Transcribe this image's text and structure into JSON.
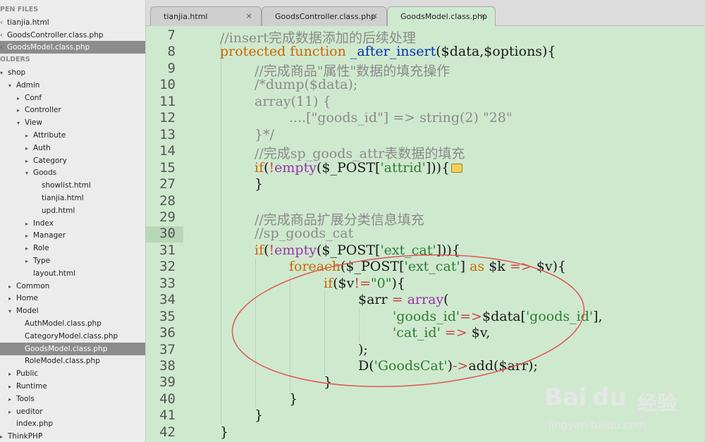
{
  "sidebar": {
    "open_files_header": "PEN FILES",
    "open_files": [
      {
        "label": "tianjia.html",
        "selected": false
      },
      {
        "label": "GoodsController.class.php",
        "selected": false
      },
      {
        "label": "GoodsModel.class.php",
        "selected": true
      }
    ],
    "folders_header": "OLDERS",
    "tree": [
      {
        "label": "shop",
        "arrow": "▾",
        "depth": 0
      },
      {
        "label": "Admin",
        "arrow": "▾",
        "depth": 1
      },
      {
        "label": "Conf",
        "arrow": "▸",
        "depth": 2
      },
      {
        "label": "Controller",
        "arrow": "▸",
        "depth": 2
      },
      {
        "label": "View",
        "arrow": "▾",
        "depth": 2
      },
      {
        "label": "Attribute",
        "arrow": "▸",
        "depth": 3
      },
      {
        "label": "Auth",
        "arrow": "▸",
        "depth": 3
      },
      {
        "label": "Category",
        "arrow": "▸",
        "depth": 3
      },
      {
        "label": "Goods",
        "arrow": "▾",
        "depth": 3
      },
      {
        "label": "showlist.html",
        "arrow": "",
        "depth": 4
      },
      {
        "label": "tianjia.html",
        "arrow": "",
        "depth": 4
      },
      {
        "label": "upd.html",
        "arrow": "",
        "depth": 4
      },
      {
        "label": "Index",
        "arrow": "▸",
        "depth": 3
      },
      {
        "label": "Manager",
        "arrow": "▸",
        "depth": 3
      },
      {
        "label": "Role",
        "arrow": "▸",
        "depth": 3
      },
      {
        "label": "Type",
        "arrow": "▸",
        "depth": 3
      },
      {
        "label": "layout.html",
        "arrow": "",
        "depth": 3
      },
      {
        "label": "Common",
        "arrow": "▸",
        "depth": 1
      },
      {
        "label": "Home",
        "arrow": "▸",
        "depth": 1
      },
      {
        "label": "Model",
        "arrow": "▾",
        "depth": 1
      },
      {
        "label": "AuthModel.class.php",
        "arrow": "",
        "depth": 2
      },
      {
        "label": "CategoryModel.class.php",
        "arrow": "",
        "depth": 2
      },
      {
        "label": "GoodsModel.class.php",
        "arrow": "",
        "depth": 2,
        "selected": true
      },
      {
        "label": "RoleModel.class.php",
        "arrow": "",
        "depth": 2
      },
      {
        "label": "Public",
        "arrow": "▸",
        "depth": 1
      },
      {
        "label": "Runtime",
        "arrow": "▸",
        "depth": 1
      },
      {
        "label": "Tools",
        "arrow": "▸",
        "depth": 1
      },
      {
        "label": "ueditor",
        "arrow": "▸",
        "depth": 1
      },
      {
        "label": "index.php",
        "arrow": "",
        "depth": 1
      },
      {
        "label": "ThinkPHP",
        "arrow": "▸",
        "depth": 0
      }
    ]
  },
  "tabs": [
    {
      "label": "tianjia.html",
      "close": "×",
      "active": false
    },
    {
      "label": "GoodsController.class.php",
      "close": "×",
      "active": false
    },
    {
      "label": "GoodsModel.class.php",
      "close": "×",
      "active": true
    }
  ],
  "editor": {
    "lines": [
      {
        "num": "7",
        "indent": 1,
        "tokens": [
          [
            "c-comment",
            "//insert完成数据添加的后续处理"
          ]
        ]
      },
      {
        "num": "8",
        "indent": 1,
        "tokens": [
          [
            "c-kw",
            "protected "
          ],
          [
            "c-kw",
            "function "
          ],
          [
            "c-fn",
            "_after_insert"
          ],
          [
            "c-plain",
            "($data,$options){"
          ]
        ]
      },
      {
        "num": "9",
        "indent": 2,
        "tokens": [
          [
            "c-comment",
            "//完成商品\"属性\"数据的填充操作"
          ]
        ]
      },
      {
        "num": "10",
        "indent": 2,
        "tokens": [
          [
            "c-comment",
            "/*dump($data);"
          ]
        ]
      },
      {
        "num": "11",
        "indent": 2,
        "tokens": [
          [
            "c-comment",
            "array(11) {"
          ]
        ]
      },
      {
        "num": "12",
        "indent": 3,
        "tokens": [
          [
            "c-comment",
            "....[\"goods_id\"] => string(2) \"28\""
          ]
        ]
      },
      {
        "num": "13",
        "indent": 2,
        "tokens": [
          [
            "c-comment",
            "}*/"
          ]
        ]
      },
      {
        "num": "14",
        "indent": 2,
        "tokens": [
          [
            "c-comment",
            "//完成sp_goods_attr表数据的填充"
          ]
        ]
      },
      {
        "num": "15",
        "indent": 2,
        "tokens": [
          [
            "c-kw",
            "if"
          ],
          [
            "c-plain",
            "("
          ],
          [
            "c-op",
            "!"
          ],
          [
            "c-builtin",
            "empty"
          ],
          [
            "c-plain",
            "($_POST["
          ],
          [
            "c-str",
            "'attrid'"
          ],
          [
            "c-plain",
            "])){"
          ]
        ],
        "fold_badge": true
      },
      {
        "num": "27",
        "indent": 2,
        "tokens": [
          [
            "c-plain",
            "}"
          ]
        ]
      },
      {
        "num": "28",
        "indent": 0,
        "tokens": []
      },
      {
        "num": "29",
        "indent": 2,
        "tokens": [
          [
            "c-comment",
            "//完成商品扩展分类信息填充"
          ]
        ]
      },
      {
        "num": "30",
        "indent": 2,
        "tokens": [
          [
            "c-comment",
            "//sp_goods_cat"
          ]
        ]
      },
      {
        "num": "31",
        "indent": 2,
        "tokens": [
          [
            "c-kw",
            "if"
          ],
          [
            "c-plain",
            "("
          ],
          [
            "c-op",
            "!"
          ],
          [
            "c-builtin",
            "empty"
          ],
          [
            "c-plain",
            "($_POST["
          ],
          [
            "c-str",
            "'ext_cat'"
          ],
          [
            "c-plain",
            "])){"
          ]
        ]
      },
      {
        "num": "32",
        "indent": 3,
        "tokens": [
          [
            "c-kw",
            "foreach"
          ],
          [
            "c-plain",
            "($_POST["
          ],
          [
            "c-str",
            "'ext_cat'"
          ],
          [
            "c-plain",
            "] "
          ],
          [
            "c-kw",
            "as"
          ],
          [
            "c-plain",
            " $k "
          ],
          [
            "c-op",
            "=>"
          ],
          [
            "c-plain",
            " $v){"
          ]
        ]
      },
      {
        "num": "33",
        "indent": 4,
        "tokens": [
          [
            "c-kw",
            "if"
          ],
          [
            "c-plain",
            "($v"
          ],
          [
            "c-op",
            "!="
          ],
          [
            "c-str",
            "\"0\""
          ],
          [
            "c-plain",
            "){"
          ]
        ]
      },
      {
        "num": "34",
        "indent": 5,
        "tokens": [
          [
            "c-plain",
            "$arr "
          ],
          [
            "c-op",
            "="
          ],
          [
            "c-plain",
            " "
          ],
          [
            "c-builtin",
            "array"
          ],
          [
            "c-plain",
            "("
          ]
        ]
      },
      {
        "num": "35",
        "indent": 6,
        "tokens": [
          [
            "c-str",
            "'goods_id'"
          ],
          [
            "c-op",
            "=>"
          ],
          [
            "c-plain",
            "$data["
          ],
          [
            "c-str",
            "'goods_id'"
          ],
          [
            "c-plain",
            "],"
          ]
        ]
      },
      {
        "num": "36",
        "indent": 6,
        "tokens": [
          [
            "c-str",
            "'cat_id'"
          ],
          [
            "c-plain",
            " "
          ],
          [
            "c-op",
            "=>"
          ],
          [
            "c-plain",
            " $v,"
          ]
        ]
      },
      {
        "num": "37",
        "indent": 5,
        "tokens": [
          [
            "c-plain",
            ");"
          ]
        ]
      },
      {
        "num": "38",
        "indent": 5,
        "tokens": [
          [
            "c-plain",
            "D("
          ],
          [
            "c-str",
            "'GoodsCat'"
          ],
          [
            "c-plain",
            ")"
          ],
          [
            "c-op",
            "->"
          ],
          [
            "c-plain",
            "add($arr);"
          ]
        ]
      },
      {
        "num": "39",
        "indent": 4,
        "tokens": [
          [
            "c-plain",
            "}"
          ]
        ]
      },
      {
        "num": "40",
        "indent": 3,
        "tokens": [
          [
            "c-plain",
            "}"
          ]
        ]
      },
      {
        "num": "41",
        "indent": 2,
        "tokens": [
          [
            "c-plain",
            "}"
          ]
        ]
      },
      {
        "num": "42",
        "indent": 1,
        "tokens": [
          [
            "c-plain",
            "}"
          ]
        ]
      }
    ],
    "current_line": "30"
  },
  "annotation": {
    "color": "#e05555"
  },
  "watermark": {
    "brand": "Bai",
    "brand2": "du",
    "cn": "经验",
    "url": "jingyan.baidu.com"
  }
}
